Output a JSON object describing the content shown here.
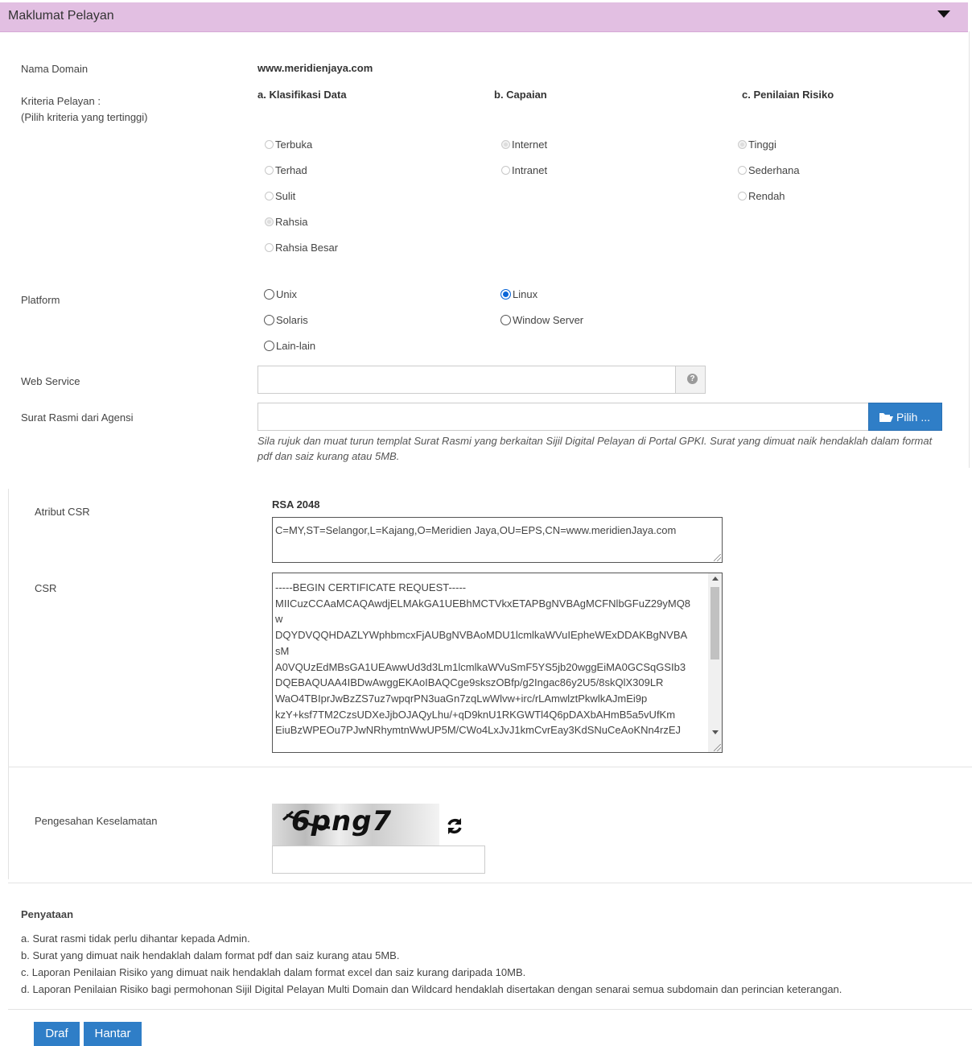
{
  "panel": {
    "title": "Maklumat Pelayan"
  },
  "domain": {
    "label": "Nama Domain",
    "value": "www.meridienjaya.com"
  },
  "criteria": {
    "label_line1": "Kriteria Pelayan :",
    "label_line2": "(Pilih kriteria yang tertinggi)",
    "classification": {
      "heading": "a. Klasifikasi Data",
      "options": [
        "Terbuka",
        "Terhad",
        "Sulit",
        "Rahsia",
        "Rahsia Besar"
      ],
      "selected": "Rahsia"
    },
    "reach": {
      "heading": "b. Capaian",
      "options": [
        "Internet",
        "Intranet"
      ],
      "selected": "Internet"
    },
    "risk": {
      "heading": "c. Penilaian Risiko",
      "options": [
        "Tinggi",
        "Sederhana",
        "Rendah"
      ],
      "selected": "Tinggi"
    }
  },
  "platform": {
    "label": "Platform",
    "options": [
      "Unix",
      "Linux",
      "Solaris",
      "Window Server",
      "Lain-lain"
    ],
    "selected": "Linux"
  },
  "web_service": {
    "label": "Web Service",
    "value": "",
    "help_icon": "question-circle-icon"
  },
  "letter": {
    "label": "Surat Rasmi dari Agensi",
    "value": "",
    "button_label": "Pilih ...",
    "button_icon": "folder-open-icon",
    "help_text": "Sila rujuk dan muat turun templat Surat Rasmi yang berkaitan Sijil Digital Pelayan di Portal GPKI. Surat yang dimuat naik hendaklah dalam format pdf dan saiz kurang atau 5MB."
  },
  "csr_attr": {
    "label": "Atribut CSR",
    "key_type": "RSA 2048",
    "value": "C=MY,ST=Selangor,L=Kajang,O=Meridien Jaya,OU=EPS,CN=www.meridienJaya.com"
  },
  "csr": {
    "label": "CSR",
    "lines": [
      "-----BEGIN CERTIFICATE REQUEST-----",
      "MIICuzCCAaMCAQAwdjELMAkGA1UEBhMCTVkxETAPBgNVBAgMCFNlbGFuZ29yMQ8",
      "w",
      "DQYDVQQHDAZLYWphbmcxFjAUBgNVBAoMDU1lcmlkaWVuIEpheWExDDAKBgNVBA",
      "sM",
      "A0VQUzEdMBsGA1UEAwwUd3d3Lm1lcmlkaWVuSmF5YS5jb20wggEiMA0GCSqGSIb3",
      "DQEBAQUAA4IBDwAwggEKAoIBAQCge9skszOBfp/g2Ingac86y2U5/8skQlX309LR",
      "WaO4TBIprJwBzZS7uz7wpqrPN3uaGn7zqLwWlvw+irc/rLAmwlztPkwlkAJmEi9p",
      "kzY+ksf7TM2CzsUDXeJjbOJAQyLhu/+qD9knU1RKGWTl4Q6pDAXbAHmB5a5vUfKm",
      "EiuBzWPEOu7PJwNRhymtnWwUP5M/CWo4LxJvJ1kmCvrEay3KdSNuCeAoKNn4rzEJ"
    ]
  },
  "security": {
    "label": "Pengesahan Keselamatan",
    "captcha_text": "6png7",
    "refresh_icon": "refresh-icon",
    "value": ""
  },
  "statement": {
    "heading": "Penyataan",
    "items": [
      "a. Surat rasmi tidak perlu dihantar kepada Admin.",
      "b. Surat yang dimuat naik hendaklah dalam format pdf dan saiz kurang atau 5MB.",
      "c. Laporan Penilaian Risiko yang dimuat naik hendaklah dalam format excel dan saiz kurang daripada 10MB.",
      "d. Laporan Penilaian Risiko bagi permohonan Sijil Digital Pelayan Multi Domain dan Wildcard hendaklah disertakan dengan senarai semua subdomain dan perincian keterangan."
    ]
  },
  "actions": {
    "draft_label": "Draf",
    "submit_label": "Hantar"
  }
}
